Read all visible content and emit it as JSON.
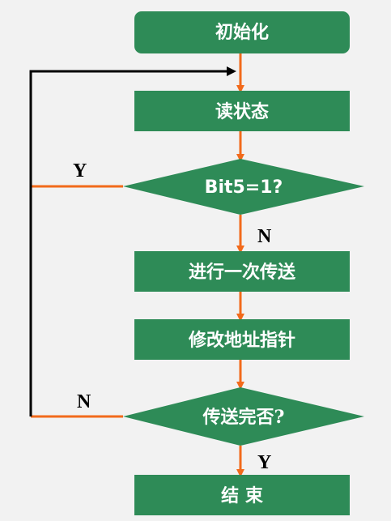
{
  "colors": {
    "node_fill": "#2e8b57",
    "arrow": "#f26a1b",
    "loop_line": "#000000",
    "background": "#f2f2f2",
    "text": "#ffffff"
  },
  "flowchart": {
    "nodes": {
      "init": "初始化",
      "read_status": "读状态",
      "check_bit5": "Bit5=1?",
      "transfer_once": "进行一次传送",
      "modify_address": "修改地址指针",
      "check_done": "传送完否?",
      "end": "结 束"
    },
    "labels": {
      "bit5_yes": "Y",
      "bit5_no": "N",
      "done_no": "N",
      "done_yes": "Y"
    }
  }
}
